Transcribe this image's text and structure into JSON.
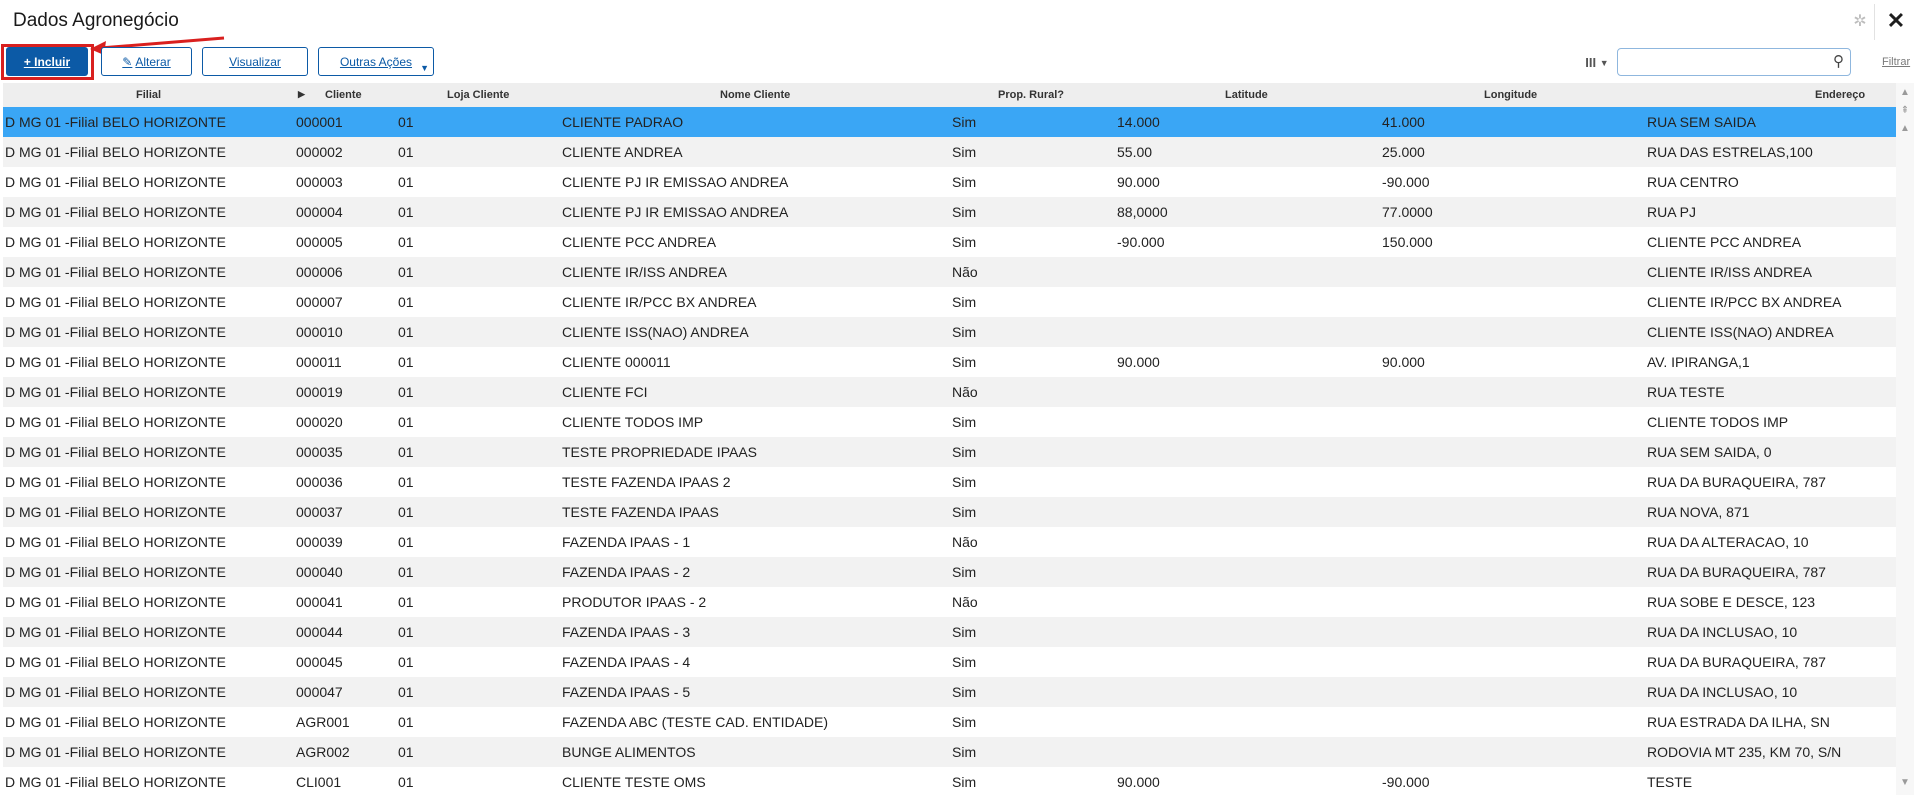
{
  "window": {
    "title": "Dados Agronegócio"
  },
  "toolbar": {
    "incluir": "+ Incluir",
    "alterar": "Alterar",
    "visualizar": "Visualizar",
    "outras_acoes": "Outras Ações",
    "filtrar": "Filtrar",
    "search_value": ""
  },
  "columns": [
    "Filial",
    "Cliente",
    "Loja Cliente",
    "Nome Cliente",
    "Prop. Rural?",
    "Latitude",
    "Longitude",
    "Endereço"
  ],
  "rows": [
    [
      "D MG 01 -Filial BELO HORIZONTE",
      "000001",
      "01",
      "CLIENTE PADRAO",
      "Sim",
      "14.000",
      "41.000",
      "RUA SEM SAIDA"
    ],
    [
      "D MG 01 -Filial BELO HORIZONTE",
      "000002",
      "01",
      "CLIENTE ANDREA",
      "Sim",
      "55.00",
      "25.000",
      "RUA DAS ESTRELAS,100"
    ],
    [
      "D MG 01 -Filial BELO HORIZONTE",
      "000003",
      "01",
      "CLIENTE PJ IR EMISSAO ANDREA",
      "Sim",
      "90.000",
      "-90.000",
      "RUA CENTRO"
    ],
    [
      "D MG 01 -Filial BELO HORIZONTE",
      "000004",
      "01",
      "CLIENTE PJ IR EMISSAO ANDREA",
      "Sim",
      "88,0000",
      "77.0000",
      "RUA PJ"
    ],
    [
      "D MG 01 -Filial BELO HORIZONTE",
      "000005",
      "01",
      "CLIENTE PCC ANDREA",
      "Sim",
      "-90.000",
      "150.000",
      "CLIENTE PCC ANDREA"
    ],
    [
      "D MG 01 -Filial BELO HORIZONTE",
      "000006",
      "01",
      "CLIENTE IR/ISS ANDREA",
      "Não",
      "",
      "",
      "CLIENTE IR/ISS ANDREA"
    ],
    [
      "D MG 01 -Filial BELO HORIZONTE",
      "000007",
      "01",
      "CLIENTE IR/PCC BX ANDREA",
      "Sim",
      "",
      "",
      "CLIENTE IR/PCC BX ANDREA"
    ],
    [
      "D MG 01 -Filial BELO HORIZONTE",
      "000010",
      "01",
      "CLIENTE ISS(NAO) ANDREA",
      "Sim",
      "",
      "",
      "CLIENTE ISS(NAO) ANDREA"
    ],
    [
      "D MG 01 -Filial BELO HORIZONTE",
      "000011",
      "01",
      "CLIENTE 000011",
      "Sim",
      "90.000",
      "90.000",
      "AV. IPIRANGA,1"
    ],
    [
      "D MG 01 -Filial BELO HORIZONTE",
      "000019",
      "01",
      "CLIENTE FCI",
      "Não",
      "",
      "",
      "RUA TESTE"
    ],
    [
      "D MG 01 -Filial BELO HORIZONTE",
      "000020",
      "01",
      "CLIENTE TODOS IMP",
      "Sim",
      "",
      "",
      "CLIENTE TODOS IMP"
    ],
    [
      "D MG 01 -Filial BELO HORIZONTE",
      "000035",
      "01",
      "TESTE PROPRIEDADE IPAAS",
      "Sim",
      "",
      "",
      "RUA SEM SAIDA, 0"
    ],
    [
      "D MG 01 -Filial BELO HORIZONTE",
      "000036",
      "01",
      "TESTE FAZENDA IPAAS 2",
      "Sim",
      "",
      "",
      "RUA DA BURAQUEIRA, 787"
    ],
    [
      "D MG 01 -Filial BELO HORIZONTE",
      "000037",
      "01",
      "TESTE FAZENDA IPAAS",
      "Sim",
      "",
      "",
      "RUA NOVA, 871"
    ],
    [
      "D MG 01 -Filial BELO HORIZONTE",
      "000039",
      "01",
      "FAZENDA IPAAS - 1",
      "Não",
      "",
      "",
      "RUA DA ALTERACAO, 10"
    ],
    [
      "D MG 01 -Filial BELO HORIZONTE",
      "000040",
      "01",
      "FAZENDA IPAAS - 2",
      "Sim",
      "",
      "",
      "RUA DA BURAQUEIRA, 787"
    ],
    [
      "D MG 01 -Filial BELO HORIZONTE",
      "000041",
      "01",
      "PRODUTOR IPAAS - 2",
      "Não",
      "",
      "",
      "RUA SOBE E DESCE, 123"
    ],
    [
      "D MG 01 -Filial BELO HORIZONTE",
      "000044",
      "01",
      "FAZENDA IPAAS - 3",
      "Sim",
      "",
      "",
      "RUA DA INCLUSAO, 10"
    ],
    [
      "D MG 01 -Filial BELO HORIZONTE",
      "000045",
      "01",
      "FAZENDA IPAAS - 4",
      "Sim",
      "",
      "",
      "RUA DA BURAQUEIRA, 787"
    ],
    [
      "D MG 01 -Filial BELO HORIZONTE",
      "000047",
      "01",
      "FAZENDA IPAAS - 5",
      "Sim",
      "",
      "",
      "RUA DA INCLUSAO, 10"
    ],
    [
      "D MG 01 -Filial BELO HORIZONTE",
      "AGR001",
      "01",
      "FAZENDA ABC (TESTE CAD. ENTIDADE)",
      "Sim",
      "",
      "",
      "RUA ESTRADA DA ILHA, SN"
    ],
    [
      "D MG 01 -Filial BELO HORIZONTE",
      "AGR002",
      "01",
      "BUNGE ALIMENTOS",
      "Sim",
      "",
      "",
      "RODOVIA MT 235, KM 70, S/N"
    ],
    [
      "D MG 01 -Filial BELO HORIZONTE",
      "CLI001",
      "01",
      "CLIENTE TESTE OMS",
      "Sim",
      "90.000",
      "-90.000",
      "TESTE"
    ]
  ],
  "selected_row": 0,
  "colors": {
    "accent": "#0c5aa6",
    "selected_row": "#3aa6f5",
    "highlight": "#d9201f"
  },
  "icons": {
    "incluir": "plus-icon",
    "alterar": "pencil-icon",
    "outras_acoes": "dropdown-caret-icon",
    "search": "magnifier-icon",
    "columns": "column-picker-icon",
    "close": "close-icon",
    "settings": "gear-icon"
  }
}
